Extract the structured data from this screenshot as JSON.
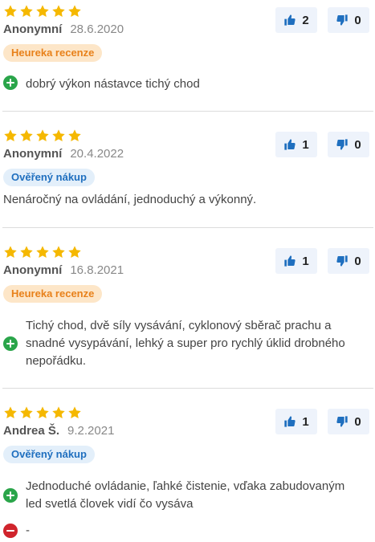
{
  "reviews": [
    {
      "rating": 5,
      "author": "Anonymní",
      "date": "28.6.2020",
      "badge": "Heureka recenze",
      "badge_type": "heureka",
      "likes": "2",
      "dislikes": "0",
      "pros": [
        "dobrý výkon nástavce tichý chod"
      ]
    },
    {
      "rating": 5,
      "author": "Anonymní",
      "date": "20.4.2022",
      "badge": "Ověřený nákup",
      "badge_type": "verified",
      "likes": "1",
      "dislikes": "0",
      "summary": "Nenáročný na ovládání, jednoduchý a výkonný."
    },
    {
      "rating": 5,
      "author": "Anonymní",
      "date": "16.8.2021",
      "badge": "Heureka recenze",
      "badge_type": "heureka",
      "likes": "1",
      "dislikes": "0",
      "pros": [
        "Tichý chod, dvě síly vysávání, cyklonový sběrač prachu a snadné vysypávání, lehký a super pro rychlý úklid drobného nepořádku."
      ]
    },
    {
      "rating": 5,
      "author": "Andrea Š.",
      "date": "9.2.2021",
      "badge": "Ověřený nákup",
      "badge_type": "verified",
      "likes": "1",
      "dislikes": "0",
      "pros": [
        "Jednoduché ovládanie, ľahké čistenie, vďaka zabudovaným led svetlá človek vidí čo vysáva"
      ],
      "cons": [
        "-"
      ]
    }
  ],
  "colors": {
    "star": "#f5b800",
    "vote_icon": "#1f6fbf",
    "plus": "#2aa54a",
    "minus": "#d0242c"
  },
  "icons": {
    "star": "star-icon",
    "thumbs_up": "thumbs-up-icon",
    "thumbs_down": "thumbs-down-icon",
    "plus": "plus-circle-icon",
    "minus": "minus-circle-icon"
  }
}
